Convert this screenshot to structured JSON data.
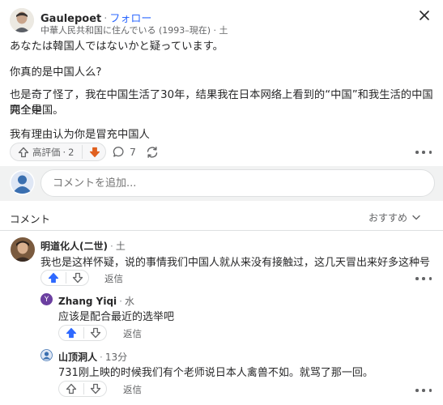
{
  "post": {
    "author": "Gaulepoet",
    "follow_label": "フォロー",
    "credential": "中華人民共和国に住んでいる (1993–現在) · 土",
    "paragraphs": [
      "あなたは韓国人ではないかと疑っています。",
      "你真的是中国人么?",
      "也是奇了怪了，我在中国生活了30年，结果我在日本网络上看到的“中国”和我生活的中国完全是",
      "两个中国。",
      "我有理由认为你是冒充中国人"
    ],
    "upvote_label": "高評価",
    "upvote_count": "2",
    "comment_count": "7"
  },
  "composer": {
    "placeholder": "コメントを追加..."
  },
  "comments_section": {
    "title": "コメント",
    "sort_label": "おすすめ"
  },
  "comments": [
    {
      "author": "明道化人(二世)",
      "time": "土",
      "text": "我也是这样怀疑，说的事情我们中国人就从来没有接触过，这几天冒出来好多这种号",
      "reply_label": "返信"
    },
    {
      "author": "Zhang Yiqi",
      "avatar_letter": "Y",
      "time": "水",
      "text": "应该是配合最近的选举吧",
      "reply_label": "返信"
    },
    {
      "author": "山顶洞人",
      "time": "13分",
      "text": "731刚上映的时候我们有个老师说日本人禽兽不如。就骂了那一回。",
      "reply_label": "返信"
    }
  ],
  "colors": {
    "accent": "#2e69ff",
    "downvote_active": "#e0601f",
    "text": "#282829",
    "muted": "#636466",
    "border": "#dee0e1",
    "zhang_avatar": "#6b3fa0"
  },
  "icons": {
    "close": "close-icon",
    "upvote": "upvote-arrow-icon",
    "downvote": "downvote-arrow-icon",
    "comment": "comment-bubble-icon",
    "share": "share-cycle-icon",
    "more": "more-dots-icon",
    "sort": "chevron-down-icon"
  }
}
